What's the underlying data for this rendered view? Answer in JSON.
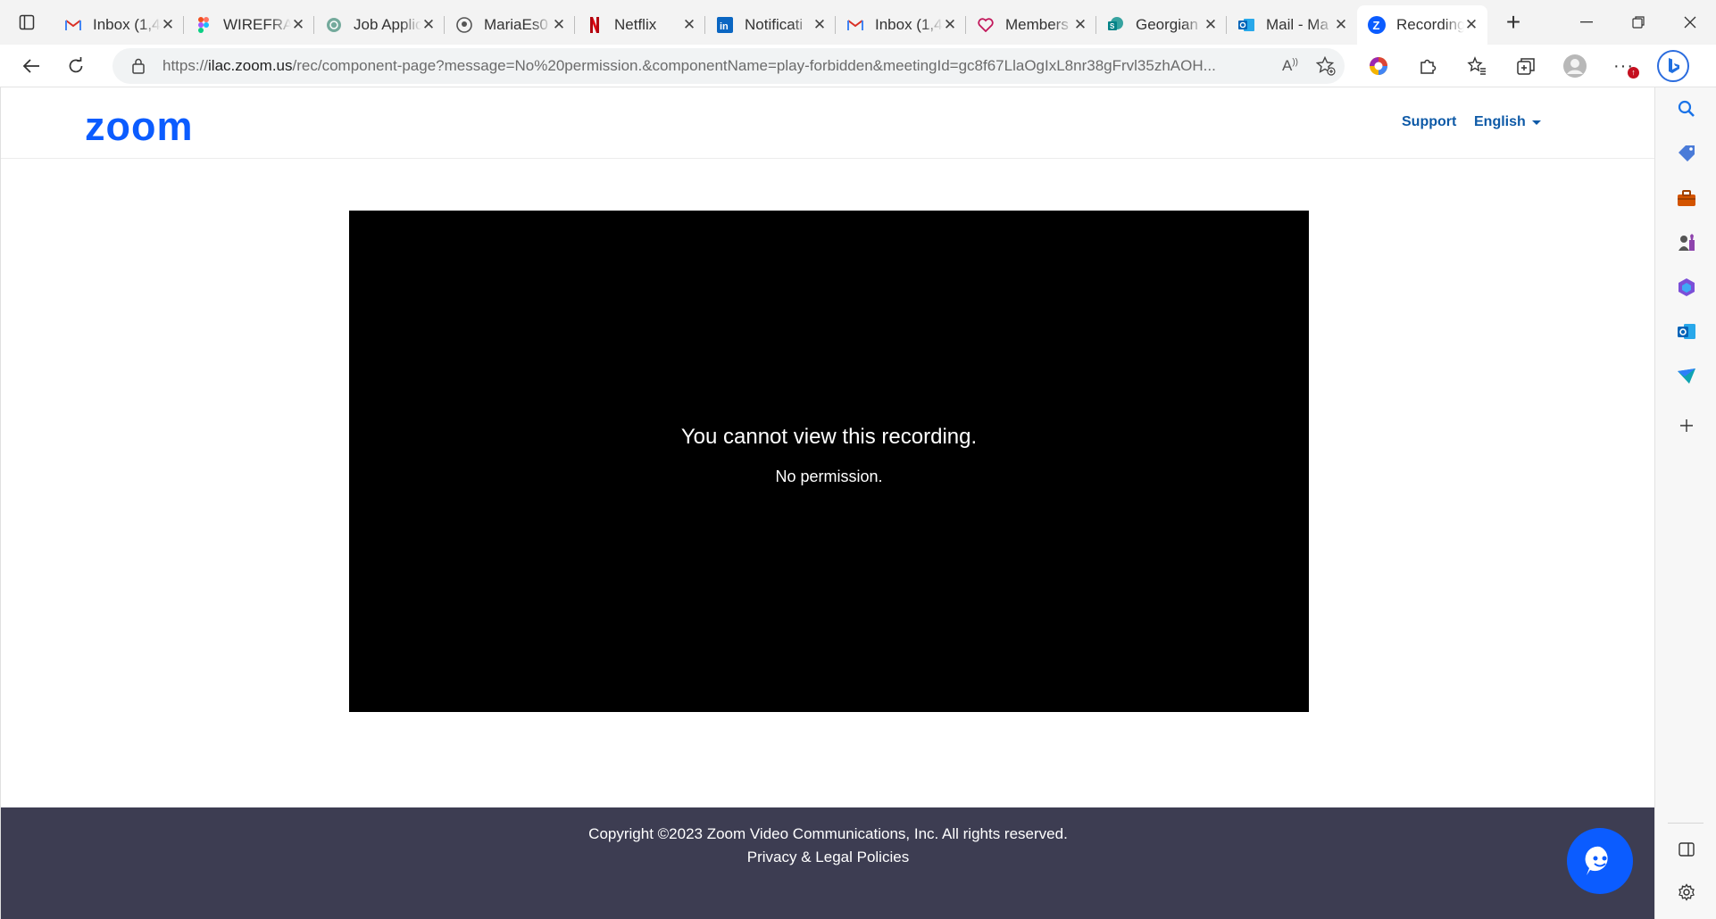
{
  "browser": {
    "tabs": [
      {
        "title": "Inbox (1,4",
        "icon": "gmail-icon"
      },
      {
        "title": "WIREFRAM",
        "icon": "figma-icon"
      },
      {
        "title": "Job Applic",
        "icon": "chatgpt-icon"
      },
      {
        "title": "MariaEs0",
        "icon": "github-icon"
      },
      {
        "title": "Netflix",
        "icon": "netflix-icon"
      },
      {
        "title": "Notificati",
        "icon": "linkedin-icon"
      },
      {
        "title": "Inbox (1,4",
        "icon": "gmail-icon"
      },
      {
        "title": "Members",
        "icon": "heart-icon"
      },
      {
        "title": "Georgian",
        "icon": "sharepoint-icon"
      },
      {
        "title": "Mail - Ma",
        "icon": "outlook-icon"
      },
      {
        "title": "Recording",
        "icon": "zoom-icon",
        "active": true
      }
    ],
    "url_prefix": "https://",
    "url_host": "ilac.zoom.us",
    "url_rest": "/rec/component-page?message=No%20permission.&componentName=play-forbidden&meetingId=gc8f67LlaOgIxL8nr38gFrvl35zhAOH..."
  },
  "header": {
    "logo": "zoom",
    "support": "Support",
    "language": "English"
  },
  "player": {
    "title": "You cannot view this recording.",
    "subtitle": "No permission."
  },
  "footer": {
    "copyright": "Copyright ©2023 Zoom Video Communications, Inc. All rights reserved.",
    "privacy": "Privacy & Legal Policies"
  },
  "colors": {
    "zoom_blue": "#0b5cff",
    "link_blue": "#0e5aa7",
    "footer_bg": "#3d3d52"
  }
}
